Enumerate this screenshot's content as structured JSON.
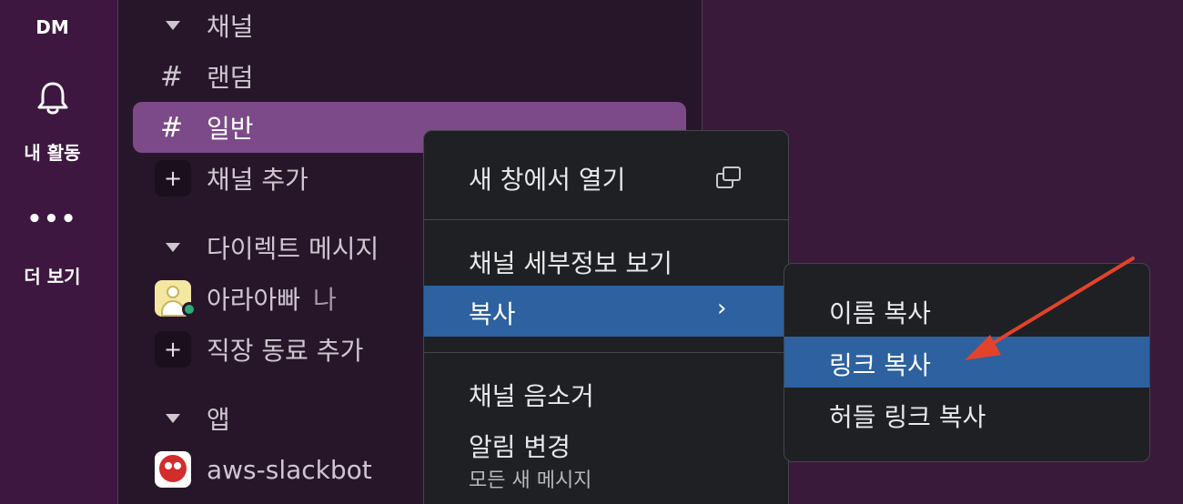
{
  "rail": {
    "dm_label": "DM",
    "activity_label": "내 활동",
    "more_dots": "•••",
    "more_label": "더 보기"
  },
  "sidebar": {
    "channels_header": "채널",
    "channels": [
      "랜덤",
      "일반"
    ],
    "add_channel": "채널 추가",
    "dm_header": "다이렉트 메시지",
    "dm_user": "아라아빠",
    "dm_user_suffix": "나",
    "add_coworker": "직장 동료 추가",
    "apps_header": "앱",
    "app_bot": "aws-slackbot"
  },
  "context_menu": {
    "open_new_window": "새 창에서 열기",
    "view_details": "채널 세부정보 보기",
    "copy": "복사",
    "mute": "채널 음소거",
    "notifications": "알림 변경",
    "notifications_sub": "모든 새 메시지"
  },
  "copy_submenu": {
    "copy_name": "이름 복사",
    "copy_link": "링크 복사",
    "copy_huddle_link": "허들 링크 복사"
  },
  "colors": {
    "rail_bg": "#3d1740",
    "sidebar_bg": "#27162a",
    "selected_bg": "#7c4a88",
    "menu_bg": "#1f2024",
    "menu_active": "#2d619f",
    "annotation_arrow": "#e2432b"
  }
}
